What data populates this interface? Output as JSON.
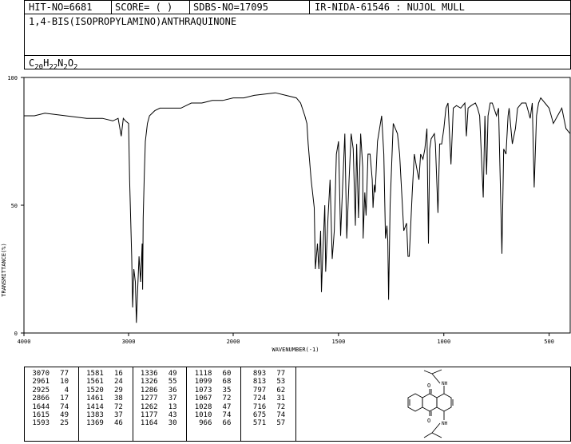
{
  "header": {
    "hit_no": "HIT-NO=6681",
    "score": "SCORE=  (    )",
    "sdbs_no": "SDBS-NO=17095",
    "ir_nida": "IR-NIDA-61546 : NUJOL MULL",
    "compound_name": "1,4-BIS(ISOPROPYLAMINO)ANTHRAQUINONE",
    "formula": {
      "c": "C",
      "c_n": "20",
      "h": "H",
      "h_n": "22",
      "n": "N",
      "n_n": "2",
      "o": "O",
      "o_n": "2"
    }
  },
  "chart_data": {
    "type": "line",
    "title": "",
    "xlabel": "WAVENUMBER(-1)",
    "ylabel": "TRANSMITTANCE(%)",
    "xlim": [
      4000,
      400
    ],
    "ylim": [
      0,
      100
    ],
    "x_ticks": [
      "4000",
      "3000",
      "2000",
      "1500",
      "1000",
      "500"
    ],
    "y_ticks": [
      "0",
      "50",
      "100"
    ],
    "series": [
      {
        "x": [
          4000,
          3900,
          3800,
          3600,
          3400,
          3250,
          3150,
          3100,
          3070,
          3050,
          3030,
          3000,
          2990,
          2970,
          2961,
          2950,
          2935,
          2925,
          2915,
          2900,
          2885,
          2870,
          2866,
          2860,
          2850,
          2840,
          2820,
          2800,
          2750,
          2700,
          2600,
          2500,
          2450,
          2400,
          2300,
          2200,
          2100,
          2000,
          1950,
          1900,
          1800,
          1750,
          1700,
          1680,
          1660,
          1650,
          1644,
          1630,
          1615,
          1610,
          1600,
          1593,
          1585,
          1581,
          1575,
          1565,
          1561,
          1550,
          1540,
          1530,
          1520,
          1510,
          1500,
          1490,
          1480,
          1470,
          1461,
          1450,
          1440,
          1430,
          1420,
          1414,
          1405,
          1395,
          1385,
          1383,
          1375,
          1369,
          1360,
          1350,
          1340,
          1336,
          1330,
          1326,
          1315,
          1305,
          1295,
          1285,
          1277,
          1270,
          1266,
          1262,
          1255,
          1240,
          1220,
          1210,
          1200,
          1190,
          1177,
          1170,
          1164,
          1150,
          1140,
          1130,
          1118,
          1110,
          1099,
          1090,
          1080,
          1073,
          1067,
          1060,
          1045,
          1040,
          1028,
          1020,
          1010,
          1000,
          990,
          980,
          966,
          955,
          940,
          920,
          900,
          893,
          885,
          870,
          850,
          840,
          830,
          813,
          805,
          797,
          790,
          780,
          770,
          750,
          740,
          724,
          716,
          705,
          695,
          690,
          675,
          660,
          650,
          630,
          610,
          600,
          590,
          580,
          571,
          560,
          550,
          540,
          520,
          500,
          480,
          460,
          440,
          420,
          400
        ],
        "y": [
          85,
          85,
          86,
          85,
          84,
          84,
          83,
          84,
          77,
          84,
          83,
          82,
          60,
          30,
          10,
          25,
          20,
          4,
          15,
          30,
          20,
          35,
          17,
          45,
          62,
          75,
          82,
          85,
          87,
          88,
          88,
          88,
          89,
          90,
          90,
          91,
          91,
          92,
          92,
          93,
          94,
          93,
          92,
          90,
          85,
          82,
          74,
          60,
          49,
          25,
          35,
          25,
          40,
          16,
          30,
          50,
          24,
          45,
          60,
          29,
          40,
          70,
          75,
          38,
          58,
          78,
          37,
          60,
          78,
          72,
          42,
          74,
          45,
          78,
          65,
          37,
          55,
          46,
          70,
          70,
          60,
          49,
          58,
          55,
          75,
          80,
          85,
          70,
          37,
          42,
          36,
          13,
          50,
          82,
          78,
          70,
          55,
          40,
          43,
          30,
          30,
          55,
          70,
          65,
          60,
          70,
          68,
          72,
          80,
          35,
          72,
          76,
          78,
          74,
          47,
          74,
          74,
          80,
          88,
          90,
          66,
          88,
          89,
          88,
          90,
          77,
          88,
          89,
          90,
          88,
          85,
          53,
          85,
          62,
          85,
          90,
          90,
          85,
          88,
          31,
          72,
          70,
          85,
          88,
          74,
          80,
          88,
          90,
          90,
          87,
          84,
          90,
          57,
          85,
          90,
          92,
          90,
          88,
          82,
          85,
          88,
          80,
          78
        ]
      }
    ],
    "peaks": [
      [
        "3070",
        "77"
      ],
      [
        "2961",
        "10"
      ],
      [
        "2925",
        "4"
      ],
      [
        "2866",
        "17"
      ],
      [
        "1644",
        "74"
      ],
      [
        "1615",
        "49"
      ],
      [
        "1593",
        "25"
      ],
      [
        "1581",
        "16"
      ],
      [
        "1561",
        "24"
      ],
      [
        "1520",
        "29"
      ],
      [
        "1461",
        "38"
      ],
      [
        "1414",
        "72"
      ],
      [
        "1383",
        "37"
      ],
      [
        "1369",
        "46"
      ],
      [
        "1336",
        "49"
      ],
      [
        "1326",
        "55"
      ],
      [
        "1286",
        "36"
      ],
      [
        "1277",
        "37"
      ],
      [
        "1262",
        "13"
      ],
      [
        "1177",
        "43"
      ],
      [
        "1164",
        "30"
      ],
      [
        "1118",
        "60"
      ],
      [
        "1099",
        "68"
      ],
      [
        "1073",
        "35"
      ],
      [
        "1067",
        "72"
      ],
      [
        "1028",
        "47"
      ],
      [
        "1010",
        "74"
      ],
      [
        "966",
        "66"
      ],
      [
        "893",
        "77"
      ],
      [
        "813",
        "53"
      ],
      [
        "797",
        "62"
      ],
      [
        "724",
        "31"
      ],
      [
        "716",
        "72"
      ],
      [
        "675",
        "74"
      ],
      [
        "571",
        "57"
      ]
    ],
    "structure_labels": {
      "top_nh": "NH",
      "bottom_nh": "NH",
      "o": "O"
    }
  }
}
